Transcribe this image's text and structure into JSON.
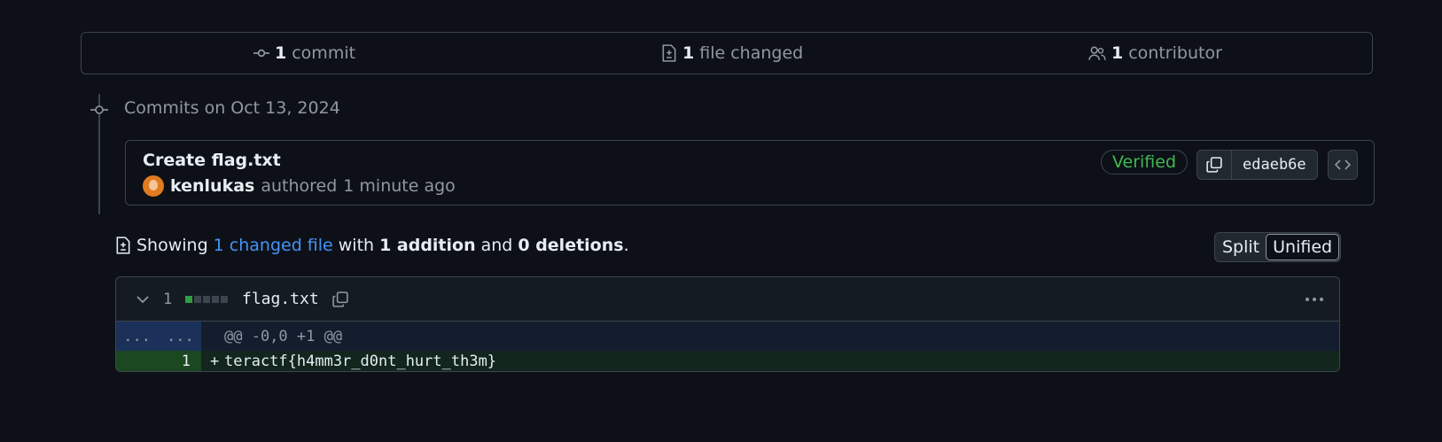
{
  "summary": {
    "commits_count": "1",
    "commits_label": "commit",
    "files_count": "1",
    "files_label": "file changed",
    "contributors_count": "1",
    "contributors_label": "contributor"
  },
  "timeline": {
    "heading": "Commits on Oct 13, 2024"
  },
  "commit": {
    "title": "Create flag.txt",
    "author": "kenlukas",
    "action": "authored",
    "time": "1 minute ago",
    "verified_label": "Verified",
    "sha": "edaeb6e"
  },
  "showing": {
    "prefix": "Showing",
    "changed_link": "1 changed file",
    "with": "with",
    "additions": "1 addition",
    "and": "and",
    "deletions": "0 deletions",
    "period": "."
  },
  "view_toggle": {
    "split": "Split",
    "unified": "Unified",
    "selected": "Unified"
  },
  "diff": {
    "change_count": "1",
    "filename": "flag.txt",
    "hunk_gutter_old": "...",
    "hunk_gutter_new": "...",
    "hunk_header": "@@ -0,0 +1 @@",
    "lines": [
      {
        "new_num": "1",
        "sign": "+",
        "code": "teractf{h4mm3r_d0nt_hurt_th3m}"
      }
    ]
  },
  "colors": {
    "background": "#0d1117",
    "border": "#3d444d",
    "muted": "#9198a1",
    "link": "#4493f8",
    "verified": "#3fb950",
    "addition_gutter": "#1b4721",
    "addition_row": "#12261e",
    "hunk_gutter": "#1b3159"
  },
  "icons": [
    "git-commit-icon",
    "file-diff-icon",
    "people-icon",
    "copy-icon",
    "code-icon",
    "chevron-down-icon",
    "kebab-icon"
  ]
}
